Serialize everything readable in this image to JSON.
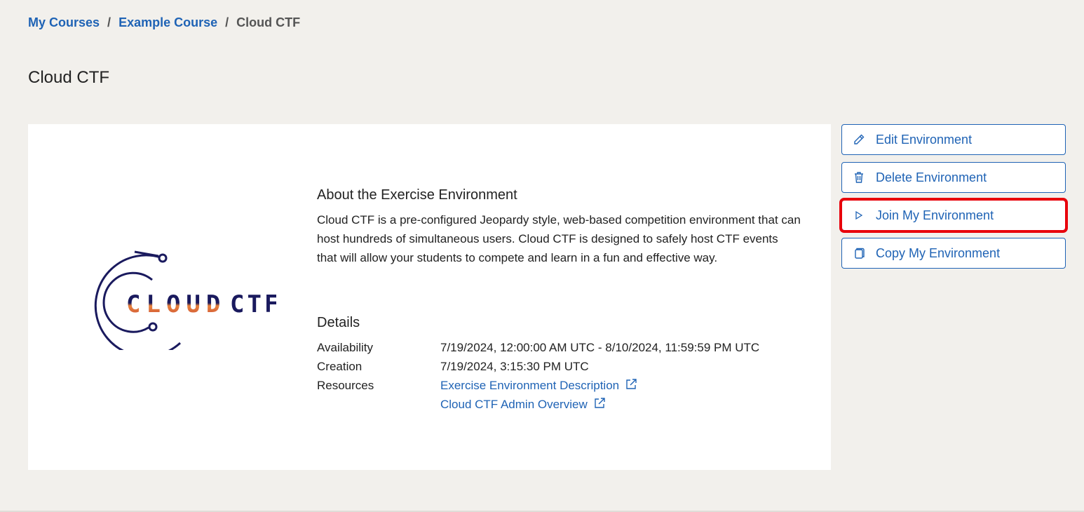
{
  "breadcrumb": {
    "items": [
      "My Courses",
      "Example Course"
    ],
    "current": "Cloud CTF",
    "separator": "/"
  },
  "page": {
    "title": "Cloud CTF"
  },
  "logo": {
    "text_left": "CLOUD",
    "text_right": "CTF"
  },
  "about": {
    "heading": "About the Exercise Environment",
    "text": "Cloud CTF is a pre-configured Jeopardy style, web-based competition environment that can host hundreds of simultaneous users. Cloud CTF is designed to safely host CTF events that will allow your students to compete and learn in a fun and effective way."
  },
  "details": {
    "heading": "Details",
    "availability_label": "Availability",
    "availability_value": "7/19/2024, 12:00:00 AM UTC - 8/10/2024, 11:59:59 PM UTC",
    "creation_label": "Creation",
    "creation_value": "7/19/2024, 3:15:30 PM UTC",
    "resources_label": "Resources",
    "resources": [
      {
        "label": "Exercise Environment Description",
        "icon": "external-link-icon"
      },
      {
        "label": "Cloud CTF Admin Overview",
        "icon": "external-link-icon"
      }
    ]
  },
  "actions": [
    {
      "label": "Edit Environment",
      "icon": "pencil-icon"
    },
    {
      "label": "Delete Environment",
      "icon": "trash-icon"
    },
    {
      "label": "Join My Environment",
      "icon": "play-icon",
      "highlighted": true
    },
    {
      "label": "Copy My Environment",
      "icon": "copy-icon"
    }
  ],
  "colors": {
    "link": "#1f63b5",
    "background": "#f2f0ec",
    "highlight": "#e8000b",
    "logo_navy": "#1a1a5e",
    "logo_orange": "#e8823a"
  }
}
